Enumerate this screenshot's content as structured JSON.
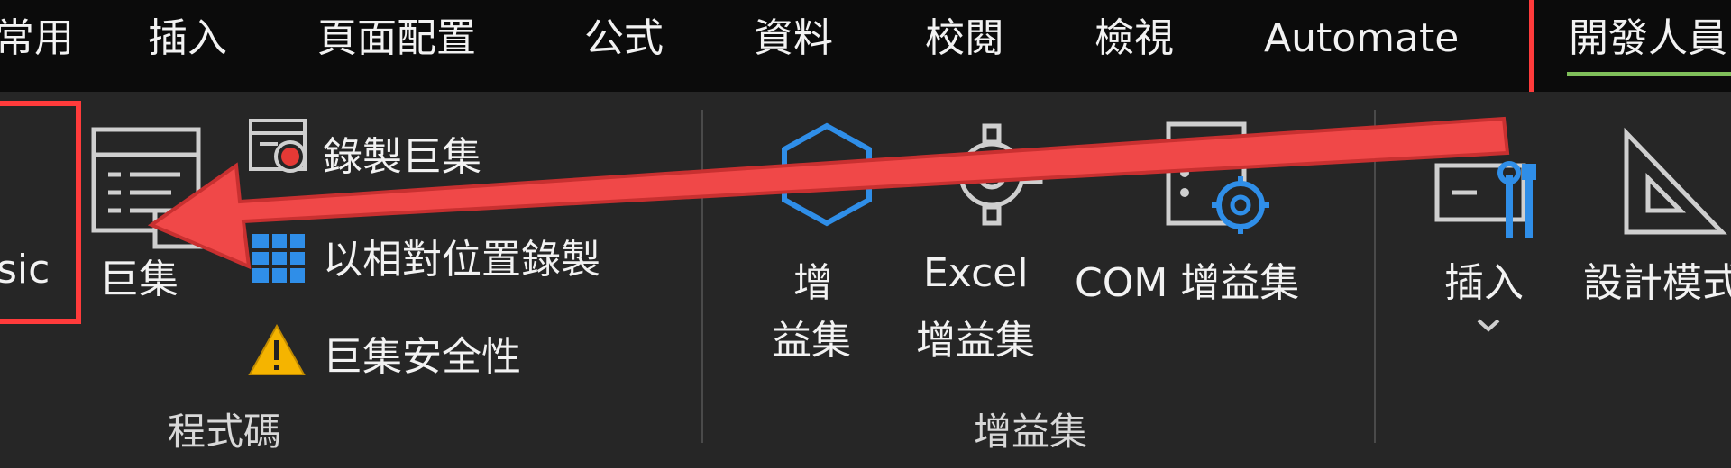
{
  "tabs": {
    "home": "常用",
    "insert": "插入",
    "page_layout": "頁面配置",
    "formulas": "公式",
    "data": "資料",
    "review": "校閱",
    "view": "檢視",
    "automate": "Automate",
    "developer": "開發人員"
  },
  "code_group": {
    "visual_basic_label": "sic",
    "macros_label": "巨集",
    "record_macro": "錄製巨集",
    "relative_ref": "以相對位置錄製",
    "macro_security": "巨集安全性",
    "group_name": "程式碼"
  },
  "addins_group": {
    "addins_line1": "增",
    "addins_line2": "益集",
    "excel_line1": "Excel",
    "excel_line2": "增益集",
    "com_addins": "COM 增益集",
    "group_name": "增益集"
  },
  "controls_group": {
    "insert_label": "插入",
    "design_mode_label": "設計模式"
  },
  "colors": {
    "tab_bar_bg": "#0b0b0b",
    "ribbon_bg": "#262626",
    "highlight_red": "#ff3b3b",
    "accent_blue": "#2f8ee8",
    "active_underline": "#7fbf5a"
  }
}
